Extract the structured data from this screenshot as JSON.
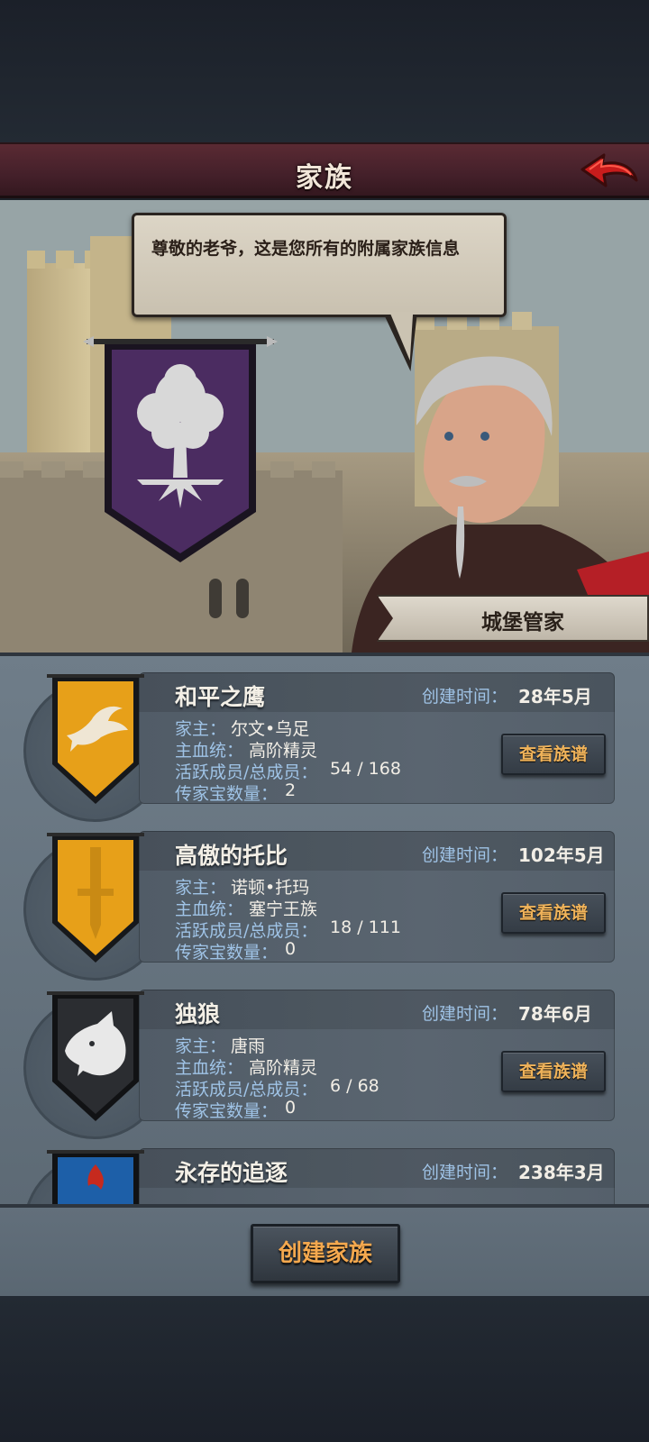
{
  "header": {
    "title": "家族"
  },
  "dialog": {
    "text": "尊敬的老爷，这是您所有的附属家族信息"
  },
  "steward": {
    "label": "城堡管家"
  },
  "labels": {
    "created": "创建时间：",
    "patriarch": "家主：",
    "bloodline": "主血统：",
    "members": "活跃成员/总成员：",
    "heirlooms": "传家宝数量：",
    "view_button": "查看族谱"
  },
  "families": [
    {
      "name": "和平之鹰",
      "created": "28年5月",
      "patriarch": "尔文•乌足",
      "bloodline": "高阶精灵",
      "members": "54 / 168",
      "heirlooms": "2",
      "banner_color": "#e7a019",
      "emblem": "dove-icon"
    },
    {
      "name": "高傲的托比",
      "created": "102年5月",
      "patriarch": "诺顿•托玛",
      "bloodline": "塞宁王族",
      "members": "18 / 111",
      "heirlooms": "0",
      "banner_color": "#e7a019",
      "emblem": "sword-icon"
    },
    {
      "name": "独狼",
      "created": "78年6月",
      "patriarch": "唐雨",
      "bloodline": "高阶精灵",
      "members": "6 / 68",
      "heirlooms": "0",
      "banner_color": "#2b2d31",
      "emblem": "wolf-icon"
    },
    {
      "name": "永存的追逐",
      "created": "238年3月",
      "banner_color": "#1d5fa8",
      "emblem": "flame-icon"
    }
  ],
  "footer": {
    "create_button": "创建家族"
  },
  "colors": {
    "header": "#4a2229",
    "accent": "#f0b35a",
    "info_label": "#9fc3e6",
    "panel": "#66737f"
  }
}
